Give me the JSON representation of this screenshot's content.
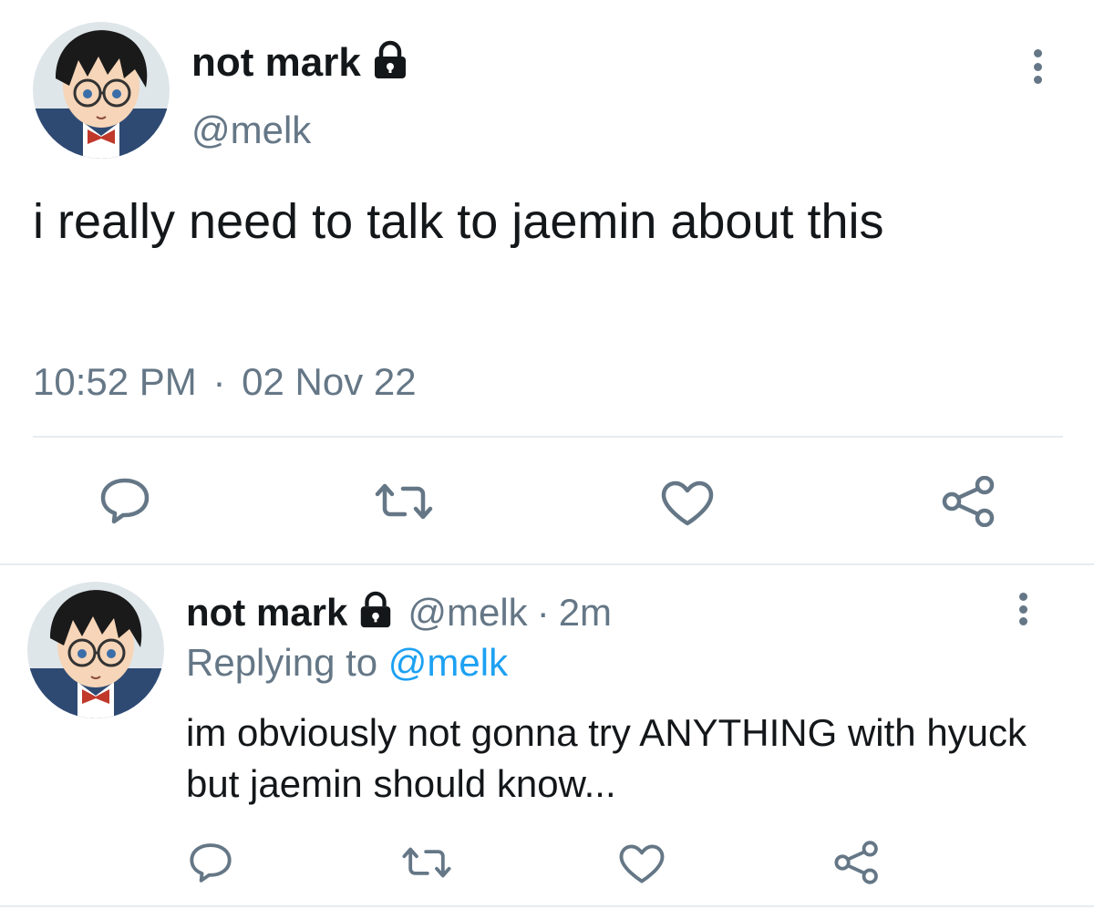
{
  "main_tweet": {
    "display_name": "not mark",
    "handle": "@melk",
    "text": "i really need to talk to jaemin about this",
    "time": "10:52 PM",
    "separator": "·",
    "date": "02 Nov 22",
    "protected_icon": "lock-icon",
    "actions": [
      "reply-icon",
      "retweet-icon",
      "like-icon",
      "share-icon"
    ]
  },
  "reply_tweet": {
    "display_name": "not mark",
    "handle": "@melk",
    "dot": "·",
    "time_ago": "2m",
    "replying_prefix": "Replying to",
    "replying_to": "@melk",
    "text": "im obviously not gonna try ANYTHING with hyuck but jaemin should know...",
    "actions": [
      "reply-icon",
      "retweet-icon",
      "like-icon",
      "share-icon"
    ]
  },
  "colors": {
    "text": "#14171a",
    "secondary": "#657786",
    "link": "#1da1f2",
    "divider": "#e6ecf0"
  }
}
